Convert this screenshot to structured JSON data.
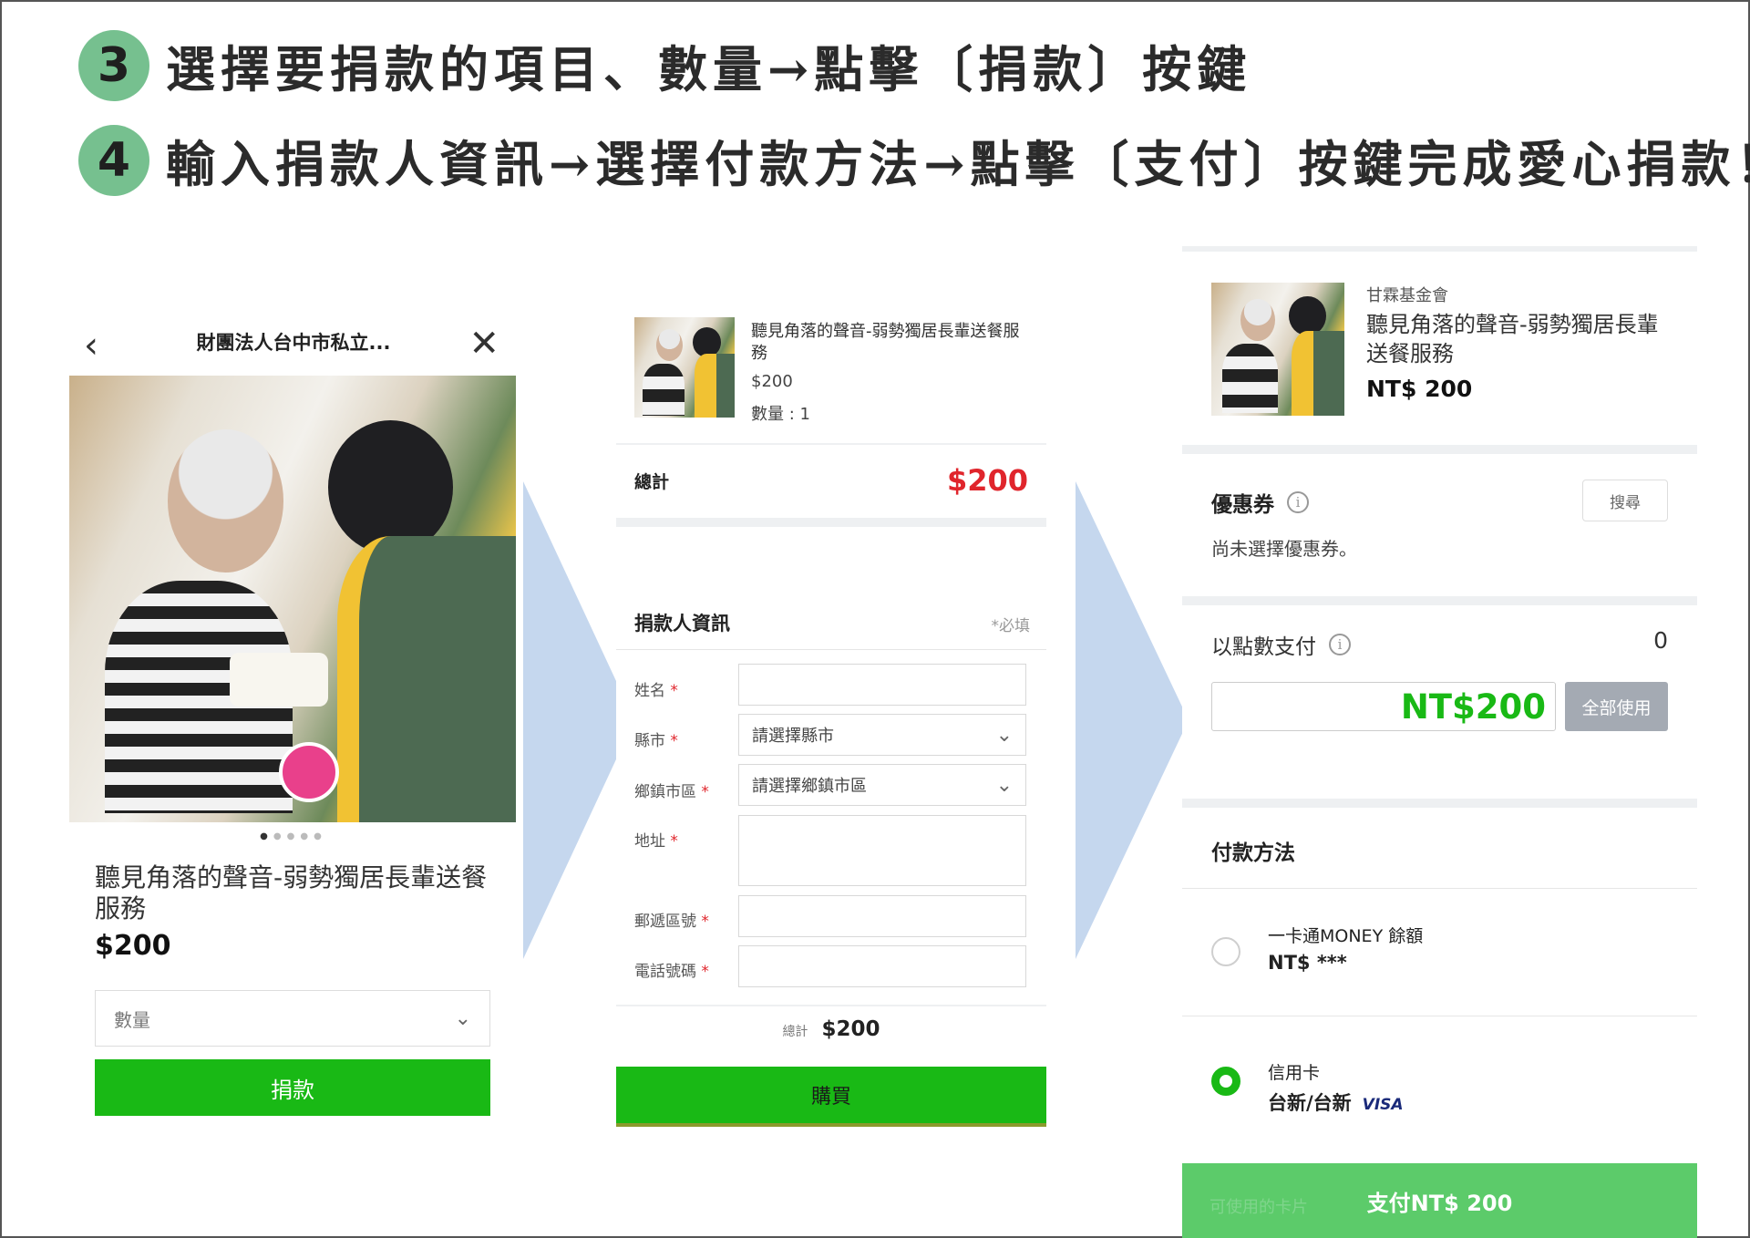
{
  "instructions": {
    "step3": {
      "number": "3",
      "text": "選擇要捐款的項目、數量→點擊〔捐款〕按鍵"
    },
    "step4": {
      "number": "4",
      "text": "輸入捐款人資訊→選擇付款方法→點擊〔支付〕按鍵完成愛心捐款！"
    }
  },
  "panel1": {
    "back_icon": "‹",
    "close_icon": "✕",
    "title": "財團法人台中市私立...",
    "item_name": "聽見角落的聲音-弱勢獨居長輩送餐服務",
    "price": "$200",
    "quantity_placeholder": "數量",
    "donate_label": "捐款"
  },
  "panel2": {
    "item_name": "聽見角落的聲音-弱勢獨居長輩送餐服務",
    "item_price": "$200",
    "item_qty": "數量 : 1",
    "total_label": "總計",
    "total_value": "$200",
    "section_title": "捐款人資訊",
    "required_note": "*必填",
    "fields": {
      "name": "姓名",
      "city": "縣市",
      "city_placeholder": "請選擇縣市",
      "district": "鄉鎮市區",
      "district_placeholder": "請選擇鄉鎮市區",
      "address": "地址",
      "zip": "郵遞區號",
      "phone": "電話號碼",
      "required_mark": "*"
    },
    "bottom_total_label": "總計",
    "bottom_total_value": "$200",
    "buy_label": "購買"
  },
  "panel3": {
    "org": "甘霖基金會",
    "item_name": "聽見角落的聲音-弱勢獨居長輩送餐服務",
    "price": "NT$ 200",
    "coupon_title": "優惠券",
    "coupon_search": "搜尋",
    "coupon_text": "尚未選擇優惠券。",
    "points_title": "以點數支付",
    "points_value": "0",
    "points_input_value": "NT$200",
    "use_all_label": "全部使用",
    "payment_title": "付款方法",
    "options": [
      {
        "name": "一卡通MONEY 餘額",
        "detail": "NT$ ***",
        "selected": false
      },
      {
        "name": "信用卡",
        "detail": "台新/台新",
        "brand": "VISA",
        "selected": true
      }
    ],
    "pay_button_label": "支付NT$ 200",
    "pay_ghost_text": "可使用的卡片"
  },
  "colors": {
    "green": "#19b915",
    "step_badge": "#76c08f",
    "arrow": "#c5d7ee",
    "price_red": "#e0252c"
  }
}
